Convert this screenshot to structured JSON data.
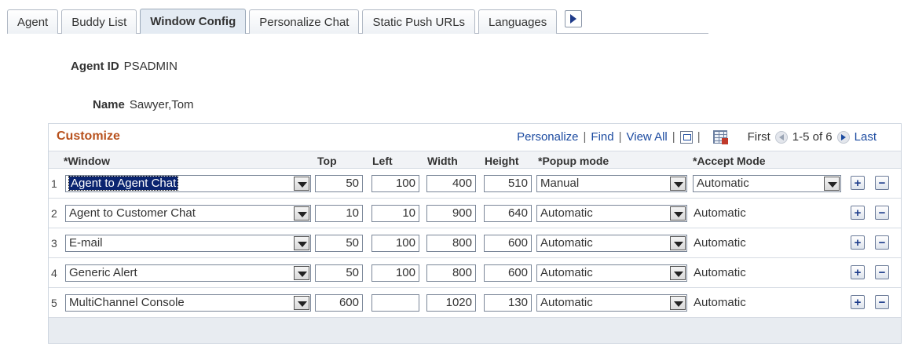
{
  "tabs": [
    {
      "label": "Agent",
      "active": false
    },
    {
      "label": "Buddy List",
      "active": false
    },
    {
      "label": "Window Config",
      "active": true
    },
    {
      "label": "Personalize Chat",
      "active": false
    },
    {
      "label": "Static Push URLs",
      "active": false
    },
    {
      "label": "Languages",
      "active": false
    }
  ],
  "agent": {
    "id_label": "Agent ID",
    "id_value": "PSADMIN",
    "name_label": "Name",
    "name_value": "Sawyer,Tom"
  },
  "grid": {
    "title": "Customize",
    "nav": {
      "personalize": "Personalize",
      "find": "Find",
      "view_all": "View All",
      "first": "First",
      "range": "1-5 of 6",
      "last": "Last"
    },
    "columns": {
      "window": "*Window",
      "top": "Top",
      "left": "Left",
      "width": "Width",
      "height": "Height",
      "popup": "*Popup mode",
      "accept": "*Accept Mode"
    },
    "rows": [
      {
        "num": "1",
        "window": "Agent to Agent Chat",
        "top": "50",
        "left": "100",
        "width": "400",
        "height": "510",
        "popup": "Manual",
        "accept": "Automatic",
        "accept_editable": true
      },
      {
        "num": "2",
        "window": "Agent to Customer Chat",
        "top": "10",
        "left": "10",
        "width": "900",
        "height": "640",
        "popup": "Automatic",
        "accept": "Automatic",
        "accept_editable": false
      },
      {
        "num": "3",
        "window": "E-mail",
        "top": "50",
        "left": "100",
        "width": "800",
        "height": "600",
        "popup": "Automatic",
        "accept": "Automatic",
        "accept_editable": false
      },
      {
        "num": "4",
        "window": "Generic Alert",
        "top": "50",
        "left": "100",
        "width": "800",
        "height": "600",
        "popup": "Automatic",
        "accept": "Automatic",
        "accept_editable": false
      },
      {
        "num": "5",
        "window": "MultiChannel Console",
        "top": "600",
        "left": "",
        "width": "1020",
        "height": "130",
        "popup": "Automatic",
        "accept": "Automatic",
        "accept_editable": false
      }
    ],
    "add_symbol": "+",
    "delete_symbol": "−"
  },
  "colors": {
    "title": "#b8521e",
    "link": "#1b4aa0",
    "selection": "#0a2470"
  }
}
